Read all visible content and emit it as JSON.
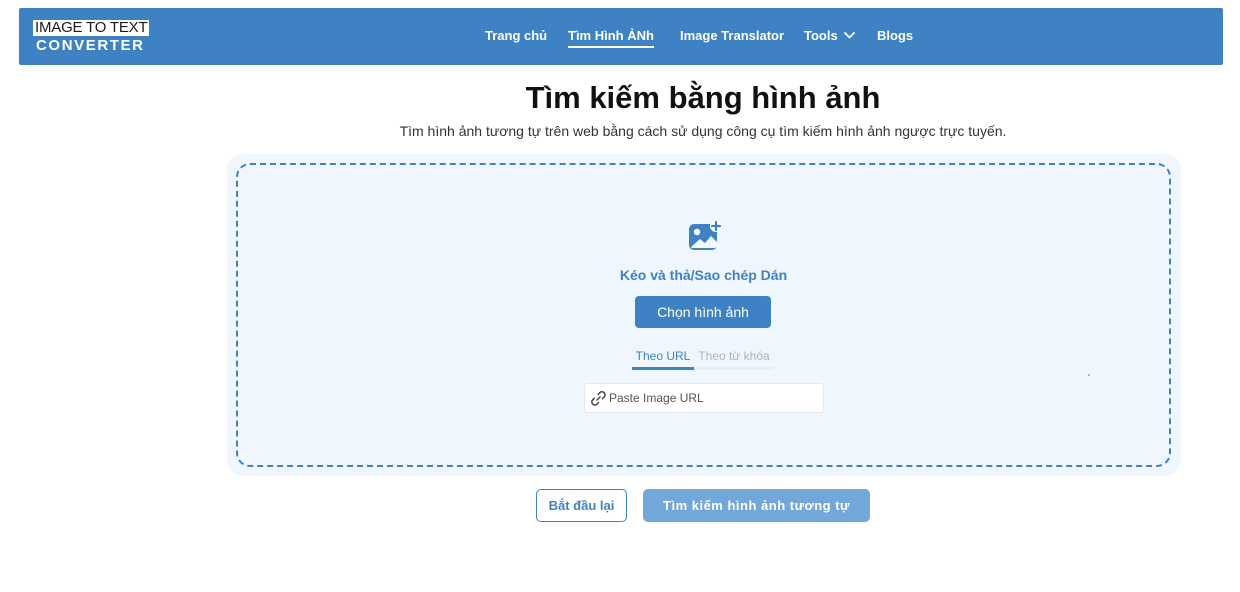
{
  "header": {
    "logo": {
      "line1": "IMAGE TO TEXT",
      "line2": "CONVERTER"
    },
    "nav": [
      {
        "label": "Trang chủ",
        "active": false
      },
      {
        "label": "Tìm Hình ẢNh",
        "active": true
      },
      {
        "label": "Image Translator",
        "active": false
      },
      {
        "label": "Tools",
        "active": false,
        "icon": "chevron-down-icon"
      },
      {
        "label": "Blogs",
        "active": false
      }
    ]
  },
  "main": {
    "title": "Tìm kiếm bằng hình ảnh",
    "subtitle": "Tìm hình ảnh tương tự trên web bằng cách sử dụng công cụ tìm kiếm hình ảnh ngược trực tuyến.",
    "upload": {
      "icon": "add-image-icon",
      "drop_label": "Kéo và thả/Sao chép Dán",
      "choose_button": "Chọn hình ảnh",
      "tabs": [
        {
          "label": "Theo URL",
          "active": true
        },
        {
          "label": "Theo từ khóa",
          "active": false
        }
      ],
      "url_input": {
        "icon": "link-icon",
        "value": "",
        "placeholder": "Paste Image URL"
      }
    },
    "actions": {
      "reset_label": "Bắt đầu lại",
      "search_label": "Tìm kiếm hình ảnh tương tự"
    }
  },
  "colors": {
    "primary": "#3e82c4",
    "primary_light": "#73a6d9",
    "dropzone_bg": "#f0f6fd"
  }
}
